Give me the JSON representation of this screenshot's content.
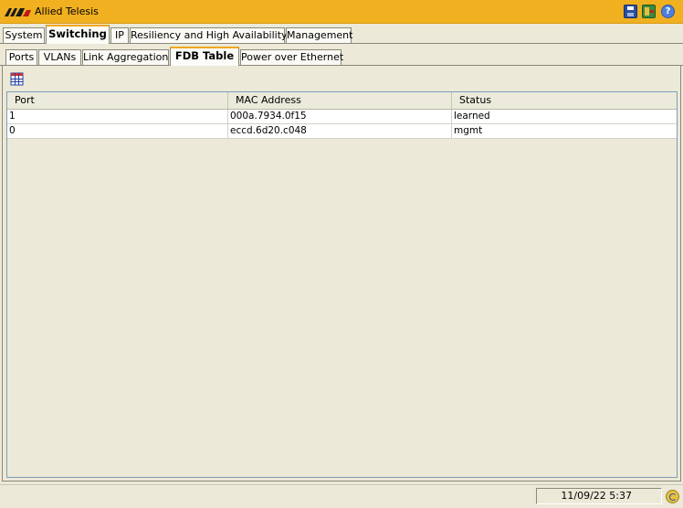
{
  "app": {
    "title": "Allied Telesis"
  },
  "titlebar": {
    "buttons": {
      "save": "save-icon",
      "logout": "logout-icon",
      "help": "?"
    }
  },
  "tabs_primary": [
    {
      "label": "System",
      "active": false
    },
    {
      "label": "Switching",
      "active": true
    },
    {
      "label": "IP",
      "active": false
    },
    {
      "label": "Resiliency and High Availability",
      "active": false
    },
    {
      "label": "Management",
      "active": false
    }
  ],
  "tabs_secondary": [
    {
      "label": "Ports",
      "active": false
    },
    {
      "label": "VLANs",
      "active": false
    },
    {
      "label": "Link Aggregation",
      "active": false
    },
    {
      "label": "FDB Table",
      "active": true
    },
    {
      "label": "Power over Ethernet",
      "active": false
    }
  ],
  "toolbar": {
    "icon": "table-columns-icon"
  },
  "fdb_table": {
    "columns": [
      "Port",
      "MAC Address",
      "Status"
    ],
    "rows": [
      {
        "port": "1",
        "mac": "000a.7934.0f15",
        "status": "learned"
      },
      {
        "port": "0",
        "mac": "eccd.6d20.c048",
        "status": "mgmt"
      }
    ]
  },
  "statusbar": {
    "datetime": "11/09/22 5:37"
  },
  "colors": {
    "titlebar": "#f0b020",
    "active_tab_accent": "#f0a820",
    "background": "#ece9d8"
  }
}
